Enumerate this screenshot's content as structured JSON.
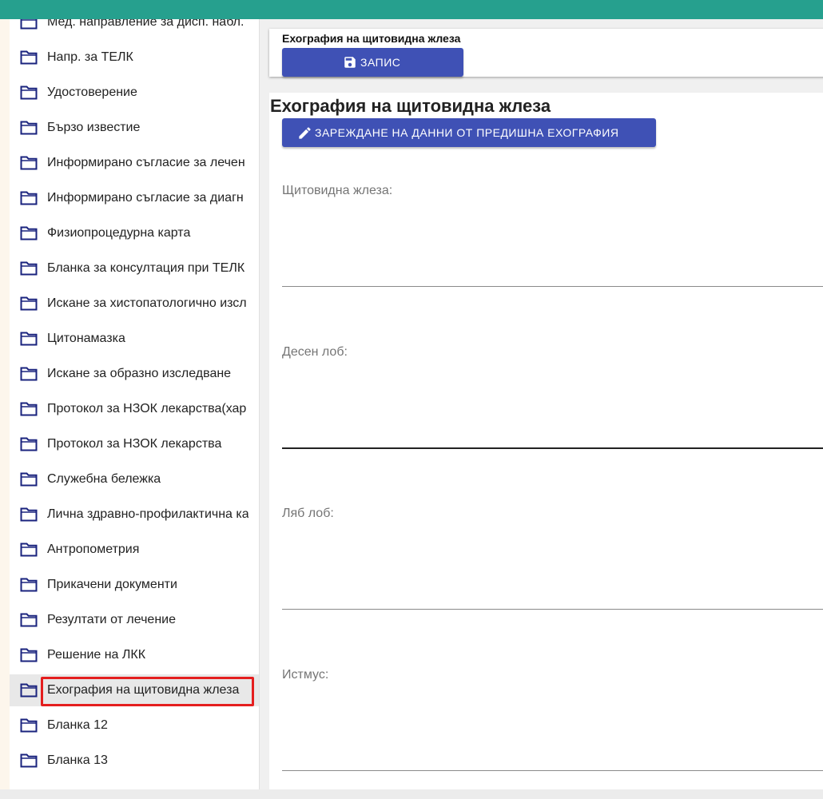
{
  "sidebar": {
    "items": [
      {
        "label": "Мед. направление за дисп. набл."
      },
      {
        "label": "Напр. за ТЕЛК"
      },
      {
        "label": "Удостоверение"
      },
      {
        "label": "Бързо известие"
      },
      {
        "label": "Информирано съгласие за лечен"
      },
      {
        "label": "Информирано съгласие за диагн"
      },
      {
        "label": "Физиопроцедурна карта"
      },
      {
        "label": "Бланка за консултация при ТЕЛК"
      },
      {
        "label": "Искане за хистопатологично изсл"
      },
      {
        "label": "Цитонамазка"
      },
      {
        "label": "Искане за образно изследване"
      },
      {
        "label": "Протокол за НЗОК лекарства(хар"
      },
      {
        "label": "Протокол за НЗОК лекарства"
      },
      {
        "label": "Служебна бележка"
      },
      {
        "label": "Лична здравно-профилактична ка"
      },
      {
        "label": "Антропометрия"
      },
      {
        "label": "Прикачени документи"
      },
      {
        "label": "Резултати от лечение"
      },
      {
        "label": "Решение на ЛКК"
      },
      {
        "label": "Ехография на щитовидна жлеза",
        "selected": true
      },
      {
        "label": "Бланка 12"
      },
      {
        "label": "Бланка 13"
      }
    ],
    "folder_icon": "folder-icon",
    "folder_icon_color": "#1a237e",
    "highlight_color": "#e41e1e"
  },
  "header": {
    "title": "Ехография на щитовидна жлеза",
    "save_label": "ЗАПИС",
    "save_icon": "floppy-disk-icon"
  },
  "form": {
    "title": "Ехография на щитовидна жлеза",
    "load_previous_label": "ЗАРЕЖДАНЕ НА ДАННИ ОТ ПРЕДИШНА ЕХОГРАФИЯ",
    "load_previous_icon": "pencil-icon",
    "fields": [
      {
        "label": "Щитовидна жлеза:",
        "value": ""
      },
      {
        "label": "Десен лоб:",
        "value": ""
      },
      {
        "label": "Ляб лоб:",
        "value": ""
      },
      {
        "label": "Истмус:",
        "value": ""
      }
    ]
  },
  "colors": {
    "topbar": "#26a08e",
    "primary_button": "#3f51b5",
    "selected_row": "#e8e8e8"
  }
}
